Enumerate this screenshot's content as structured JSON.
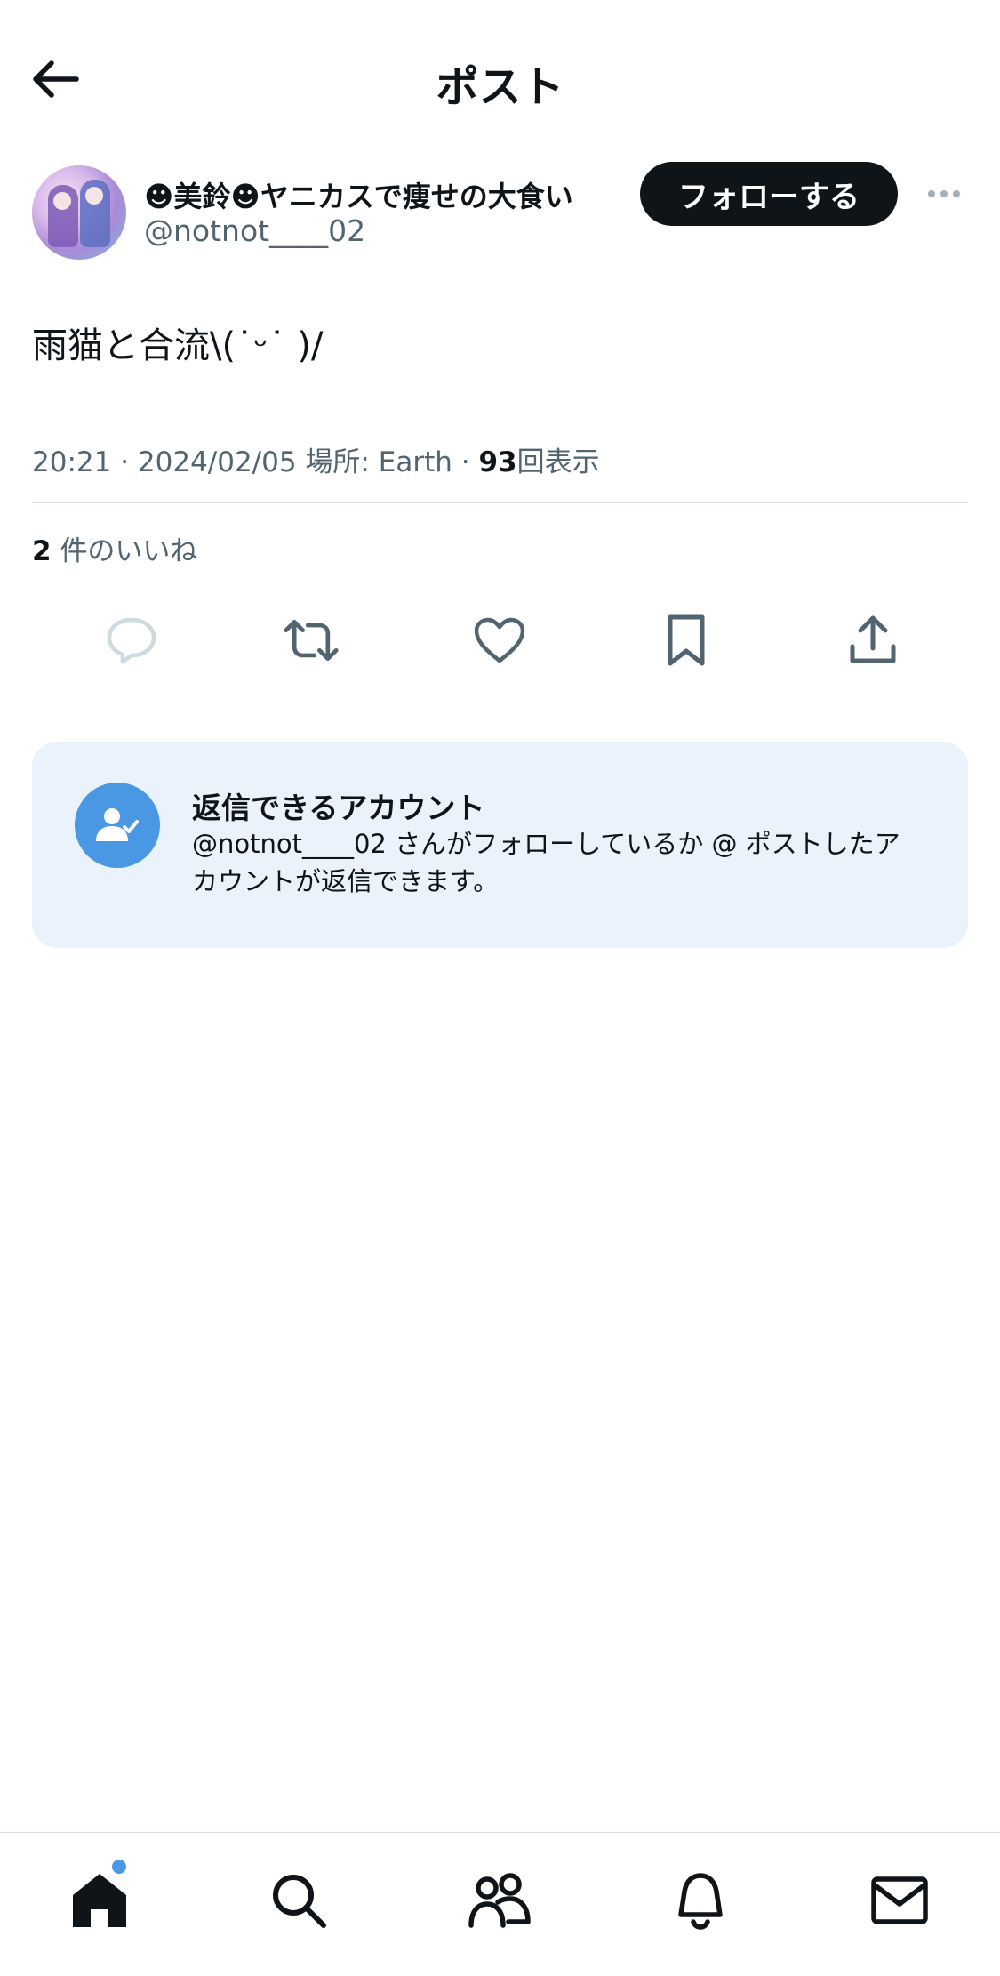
{
  "header": {
    "title": "ポスト",
    "back_icon": "arrow-left-icon"
  },
  "author": {
    "display_name": "☻美鈴☻ヤニカスで痩せの大食い",
    "handle": "@notnot____02",
    "follow_label": "フォローする",
    "more_icon": "more-horizontal-icon"
  },
  "post": {
    "text": "雨猫と合流\\(˙ᵕ˙ )/",
    "time": "20:21 · 2024/02/05",
    "location": "場所: Earth",
    "separator": "·",
    "views_count": "93",
    "views_label": "回表示",
    "likes_count": "2",
    "likes_label": "件のいいね"
  },
  "actions": [
    {
      "name": "reply-icon",
      "state": "disabled"
    },
    {
      "name": "retweet-icon",
      "state": "enabled"
    },
    {
      "name": "like-icon",
      "state": "enabled"
    },
    {
      "name": "bookmark-icon",
      "state": "enabled"
    },
    {
      "name": "share-icon",
      "state": "enabled"
    }
  ],
  "reply_info": {
    "title": "返信できるアカウント",
    "body": "@notnot____02 さんがフォローしているか @ ポストしたアカウントが返信できます。",
    "icon": "user-check-icon"
  },
  "bottom_nav": [
    {
      "name": "home-icon",
      "active": true,
      "badge": true
    },
    {
      "name": "search-icon",
      "active": false
    },
    {
      "name": "communities-icon",
      "active": false
    },
    {
      "name": "notifications-icon",
      "active": false
    },
    {
      "name": "messages-icon",
      "active": false
    }
  ],
  "colors": {
    "text_primary": "#0f1419",
    "text_secondary": "#536471",
    "accent": "#4a97e4",
    "card_bg": "#eaf3fb",
    "divider": "#dbe1e6",
    "disabled_icon": "#cfd9de"
  }
}
